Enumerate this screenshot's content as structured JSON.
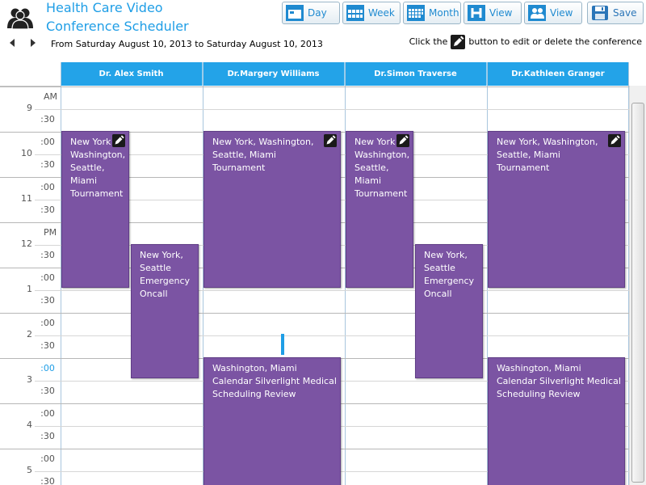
{
  "app": {
    "title": "Health Care Video Conference Scheduler",
    "icon": "people-icon"
  },
  "toolbar": {
    "buttons": [
      {
        "label": "Day",
        "icon": "day-view-icon"
      },
      {
        "label": "Week",
        "icon": "week-view-icon"
      },
      {
        "label": "Month",
        "icon": "month-view-icon"
      },
      {
        "label": "View",
        "icon": "horizontal-view-icon"
      },
      {
        "label": "View",
        "icon": "people-view-icon"
      },
      {
        "label": "Save",
        "icon": "save-icon"
      }
    ]
  },
  "nav": {
    "prev": "previous-arrow-icon",
    "next": "next-arrow-icon",
    "date_range": "From Saturday August 10, 2013 to Saturday August 10, 2013"
  },
  "hint": {
    "prefix": "Click the",
    "suffix": "button to edit or delete the conference",
    "icon": "edit-icon"
  },
  "resources": [
    "Dr. Alex Smith",
    "Dr.Margery Williams",
    "Dr.Simon Traverse",
    "Dr.Kathleen Granger"
  ],
  "time_slots": [
    {
      "hour": "9",
      "minutes": "",
      "ampm": "AM"
    },
    {
      "hour": "",
      "minutes": ":30",
      "ampm": ""
    },
    {
      "hour": "10",
      "minutes": ":00",
      "ampm": ""
    },
    {
      "hour": "",
      "minutes": ":30",
      "ampm": ""
    },
    {
      "hour": "11",
      "minutes": ":00",
      "ampm": ""
    },
    {
      "hour": "",
      "minutes": ":30",
      "ampm": ""
    },
    {
      "hour": "12",
      "minutes": "",
      "ampm": "PM"
    },
    {
      "hour": "",
      "minutes": ":30",
      "ampm": ""
    },
    {
      "hour": "1",
      "minutes": ":00",
      "ampm": ""
    },
    {
      "hour": "",
      "minutes": ":30",
      "ampm": ""
    },
    {
      "hour": "2",
      "minutes": ":00",
      "ampm": ""
    },
    {
      "hour": "",
      "minutes": ":30",
      "ampm": ""
    },
    {
      "hour": "3",
      "minutes": ":00",
      "ampm": "",
      "current": true
    },
    {
      "hour": "",
      "minutes": ":30",
      "ampm": ""
    },
    {
      "hour": "4",
      "minutes": ":00",
      "ampm": ""
    },
    {
      "hour": "",
      "minutes": ":30",
      "ampm": ""
    },
    {
      "hour": "5",
      "minutes": ":00",
      "ampm": ""
    },
    {
      "hour": "",
      "minutes": ":30",
      "ampm": ""
    }
  ],
  "appointments": [
    {
      "resource": "Dr. Alex Smith",
      "lines": [
        "New York",
        "Washington,",
        "Seattle,",
        "Miami",
        "Tournament"
      ],
      "editable": true,
      "color": "#7b54a3"
    },
    {
      "resource": "Dr. Alex Smith",
      "lines": [
        "New York,",
        "Seattle",
        "Emergency",
        "Oncall"
      ],
      "editable": false,
      "color": "#7b54a3"
    },
    {
      "resource": "Dr.Margery Williams",
      "lines": [
        "New York, Washington,",
        "Seattle, Miami",
        "Tournament"
      ],
      "editable": true,
      "color": "#7b54a3"
    },
    {
      "resource": "Dr.Margery Williams",
      "lines": [
        "Washington, Miami",
        "Calendar Silverlight Medical",
        "Scheduling Review"
      ],
      "editable": false,
      "color": "#7b54a3"
    },
    {
      "resource": "Dr.Simon Traverse",
      "lines": [
        "New York",
        "Washington,",
        "Seattle,",
        "Miami",
        "Tournament"
      ],
      "editable": true,
      "color": "#7b54a3"
    },
    {
      "resource": "Dr.Simon Traverse",
      "lines": [
        "New York,",
        "Seattle",
        "Emergency",
        "Oncall"
      ],
      "editable": false,
      "color": "#7b54a3"
    },
    {
      "resource": "Dr.Kathleen Granger",
      "lines": [
        "New York, Washington,",
        "Seattle, Miami",
        "Tournament"
      ],
      "editable": true,
      "color": "#7b54a3"
    },
    {
      "resource": "Dr.Kathleen Granger",
      "lines": [
        "Washington, Miami",
        "Calendar Silverlight Medical",
        "Scheduling Review"
      ],
      "editable": false,
      "color": "#7b54a3"
    }
  ],
  "colors": {
    "accent": "#1f9ee6",
    "header": "#23a3e8",
    "appointment": "#7b54a3"
  }
}
